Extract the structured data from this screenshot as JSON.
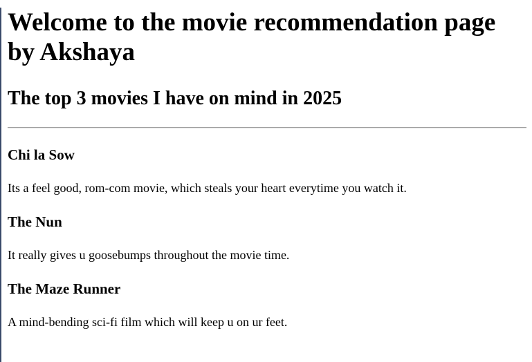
{
  "page": {
    "title": "Welcome to the movie recommendation page by Akshaya",
    "subtitle": "The top 3 movies I have on mind in 2025"
  },
  "movies": [
    {
      "title": "Chi la Sow",
      "description": "Its a feel good, rom-com movie, which steals your heart everytime you watch it."
    },
    {
      "title": "The Nun",
      "description": "It really gives u goosebumps throughout the movie time."
    },
    {
      "title": "The Maze Runner",
      "description": "A mind-bending sci-fi film which will keep u on ur feet."
    }
  ],
  "colors": {
    "text": "#000000",
    "background": "#ffffff",
    "divider": "#a0a0a0"
  }
}
